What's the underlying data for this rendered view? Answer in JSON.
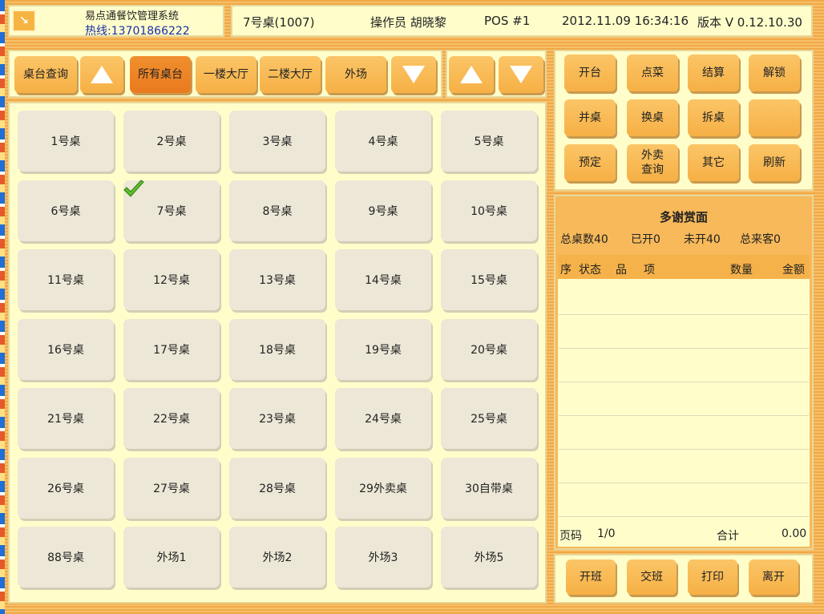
{
  "header": {
    "app_title": "易点通餐饮管理系统",
    "hotline": "热线:13701866222",
    "table": "7号桌(1007)",
    "operator": "操作员  胡晓黎",
    "pos": "POS  #1",
    "datetime": "2012.11.09 16:34:16",
    "version": "版本 V 0.12.10.30"
  },
  "area_bar": {
    "query": "桌台查询",
    "areas": [
      "所有桌台",
      "一楼大厅",
      "二楼大厅",
      "外场"
    ]
  },
  "tables": [
    "1号桌",
    "2号桌",
    "3号桌",
    "4号桌",
    "5号桌",
    "6号桌",
    "7号桌",
    "8号桌",
    "9号桌",
    "10号桌",
    "11号桌",
    "12号桌",
    "13号桌",
    "14号桌",
    "15号桌",
    "16号桌",
    "17号桌",
    "18号桌",
    "19号桌",
    "20号桌",
    "21号桌",
    "22号桌",
    "23号桌",
    "24号桌",
    "25号桌",
    "26号桌",
    "27号桌",
    "28号桌",
    "29外卖桌",
    "30自带桌",
    "88号桌",
    "外场1",
    "外场2",
    "外场3",
    "外场5"
  ],
  "actions": {
    "open": "开台",
    "order": "点菜",
    "checkout": "结算",
    "unlock": "解锁",
    "merge": "并桌",
    "change": "换桌",
    "split": "拆桌",
    "reserve": "预定",
    "takeout_line1": "外卖",
    "takeout_line2": "查询",
    "other": "其它",
    "refresh": "刷新"
  },
  "summary": {
    "title": "多谢赏面",
    "total": "总桌数40",
    "opened": "已开0",
    "unopened": "未开40",
    "guests": "总来客0"
  },
  "order_columns": [
    "序",
    "状态",
    "品",
    "项",
    "数量",
    "金额"
  ],
  "footer": {
    "page_label": "页码",
    "page": "1/0",
    "total_label": "合计",
    "total": "0.00"
  },
  "bottom": {
    "start_shift": "开班",
    "handover": "交班",
    "print": "打印",
    "leave": "离开"
  }
}
